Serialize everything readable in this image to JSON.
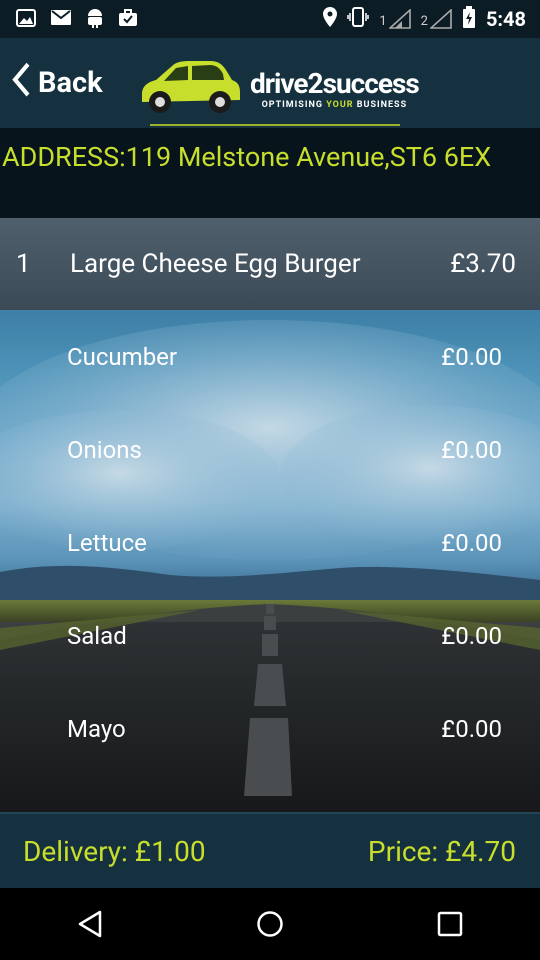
{
  "status_bar": {
    "notification_icons": [
      "image-icon",
      "mail-icon",
      "android-icon",
      "briefcase-icon"
    ],
    "sim1": "1",
    "sim2": "2",
    "time": "5:48"
  },
  "header": {
    "back_label": "Back",
    "brand_name": "drive2success",
    "brand_tagline_prefix": "OPTIMISING ",
    "brand_tagline_highlight": "YOUR",
    "brand_tagline_suffix": " BUSINESS"
  },
  "address": "ADDRESS:119 Melstone Avenue,ST6 6EX",
  "order": {
    "qty": "1",
    "name": "Large Cheese Egg Burger",
    "price": "£3.70"
  },
  "extras": [
    {
      "name": "Cucumber",
      "price": "£0.00"
    },
    {
      "name": "Onions",
      "price": "£0.00"
    },
    {
      "name": "Lettuce",
      "price": "£0.00"
    },
    {
      "name": "Salad",
      "price": "£0.00"
    },
    {
      "name": "Mayo",
      "price": "£0.00"
    }
  ],
  "footer": {
    "delivery": "Delivery: £1.00",
    "price": "Price: £4.70"
  },
  "colors": {
    "accent": "#c8de2c",
    "header_bg": "#15313f",
    "address_bg": "#07141c"
  }
}
